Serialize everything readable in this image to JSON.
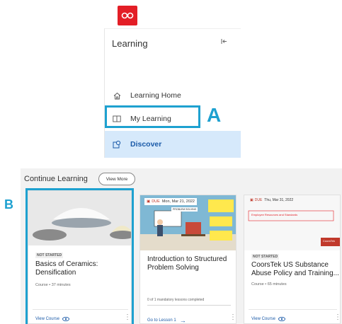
{
  "panel": {
    "title": "Learning",
    "items": [
      {
        "label": "Learning Home",
        "icon": "home-icon"
      },
      {
        "label": "My Learning",
        "icon": "book-icon"
      },
      {
        "label": "Discover",
        "icon": "discover-icon"
      }
    ]
  },
  "annotations": {
    "a": "A",
    "b": "B"
  },
  "continue_learning": {
    "title": "Continue Learning",
    "view_more": "View More",
    "cards": [
      {
        "status": "NOT STARTED",
        "title": "Basics of Ceramics: Densification",
        "meta": "Course • 37 minutes",
        "action": "View Course"
      },
      {
        "due_label": "DUE",
        "due_date": "Mon, Mar 21, 2022",
        "thumb_banner": "PROBLEM SOLVING",
        "title": "Introduction to Structured Problem Solving",
        "progress_text": "0 of 1 mandatory lessons completed",
        "action": "Go to Lesson 1"
      },
      {
        "due_label": "DUE",
        "due_date": "Thu, Mar 31, 2022",
        "thumb_text": "Employee Resources and Standards",
        "thumb_brand": "CoorsTek",
        "status": "NOT STARTED",
        "title": "CoorsTek US Substance Abuse Policy and Training...",
        "meta": "Course • 65 minutes",
        "action": "View Course"
      }
    ]
  },
  "colors": {
    "accent": "#1ea1d0",
    "brand": "#e31e26",
    "active_bg": "#d6e9fb",
    "link": "#1a5aa8"
  }
}
